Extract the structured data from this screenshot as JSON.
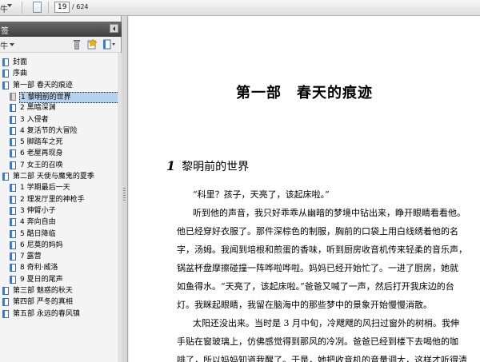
{
  "toolbar": {
    "truncated_label": "牛",
    "page_current": "19",
    "page_total": "/ 624"
  },
  "panel": {
    "title": "签",
    "options_label": "牛"
  },
  "bookmarks": [
    {
      "label": "封面",
      "indent": 0,
      "selected": false
    },
    {
      "label": "序曲",
      "indent": 0,
      "selected": false
    },
    {
      "label": "第一部 春天的痕迹",
      "indent": 0,
      "selected": false
    },
    {
      "label": "1 黎明前的世界",
      "indent": 1,
      "selected": true
    },
    {
      "label": "2 黑暗深渊",
      "indent": 1,
      "selected": false
    },
    {
      "label": "3 入侵者",
      "indent": 1,
      "selected": false
    },
    {
      "label": "4 复活节的大冒险",
      "indent": 1,
      "selected": false
    },
    {
      "label": "5 脚踏车之死",
      "indent": 1,
      "selected": false
    },
    {
      "label": "6 老屋再现身",
      "indent": 1,
      "selected": false
    },
    {
      "label": "7 女王的召唤",
      "indent": 1,
      "selected": false
    },
    {
      "label": "第二部 天使与魔鬼的夏季",
      "indent": 0,
      "selected": false
    },
    {
      "label": "1 学期最后一天",
      "indent": 1,
      "selected": false
    },
    {
      "label": "2 理发厅里的神枪手",
      "indent": 1,
      "selected": false
    },
    {
      "label": "3 伸臂小子",
      "indent": 1,
      "selected": false
    },
    {
      "label": "4 奔向自由",
      "indent": 1,
      "selected": false
    },
    {
      "label": "5 酷日降临",
      "indent": 1,
      "selected": false
    },
    {
      "label": "6 尼莫的妈妈",
      "indent": 1,
      "selected": false
    },
    {
      "label": "7 露营",
      "indent": 1,
      "selected": false
    },
    {
      "label": "8 奇利·威洛",
      "indent": 1,
      "selected": false
    },
    {
      "label": "9 夏日的尾声",
      "indent": 1,
      "selected": false
    },
    {
      "label": "第三部 魅惑的秋天",
      "indent": 0,
      "selected": false
    },
    {
      "label": "第四部 严冬的真相",
      "indent": 0,
      "selected": false
    },
    {
      "label": "第五部 永远的春风镇",
      "indent": 0,
      "selected": false
    }
  ],
  "document": {
    "part_title": "第一部　春天的痕迹",
    "chapter_number": "1",
    "chapter_title": "黎明前的世界",
    "lines": [
      "“科里？孩子，天亮了，该起床啦。”",
      "听到他的声音，我只好乖乖从幽暗的梦境中钻出来，睁开眼睛看看他。",
      "他已经穿好衣服了。那件深棕色的制服，胸前的口袋上用白线绣着他的名",
      "字，汤姆。我闻到培根和煎蛋的香味，听到厨房收音机传来轻柔的音乐声，",
      "锅盆杯盘摩擦碰撞一阵哗啦哗啦。妈妈已经开始忙了。一进了厨房，她就",
      "如鱼得水。“天亮了，该起床啦。”爸爸又喊了一声，然后打开我床边的台",
      "灯。我眯起眼睛，我留在脑海中的那些梦中的景象开始慢慢消散。",
      "太阳还没出来。当时是 3 月中旬，冷飕飕的风扫过窗外的树梢。我伸",
      "手贴在窗玻璃上，仿佛感觉得到那风的冷冽。爸爸已经到楼下去喝他的咖",
      "啡了，所以妈妈知道我醒了。于是，她把收音机的音量调大，这样才听得清"
    ]
  },
  "colors": {
    "panel_header": "#555555",
    "selected_bookmark": "#b7d2ee",
    "bookmark_icon": "#3a7bd5"
  }
}
